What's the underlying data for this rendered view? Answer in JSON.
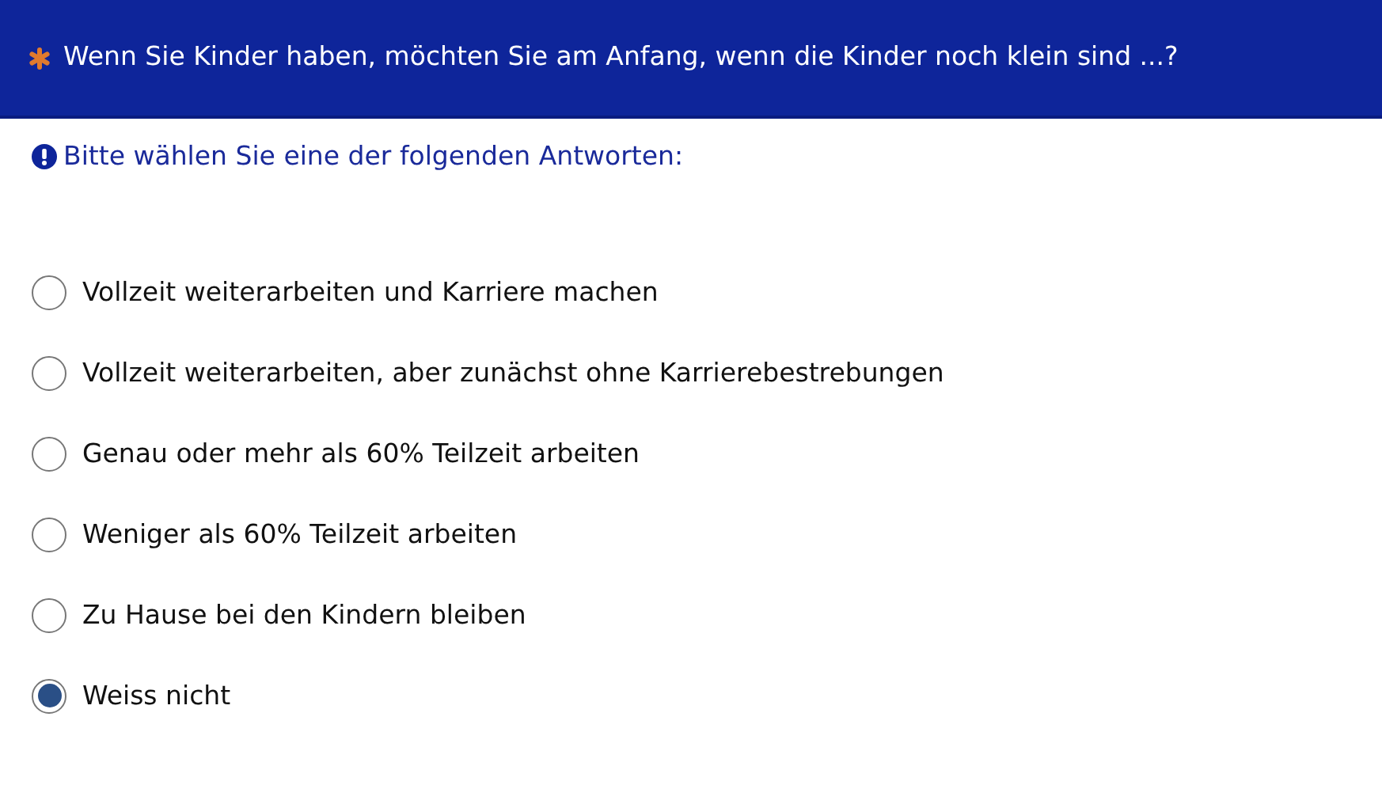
{
  "question": {
    "title": "Wenn Sie Kinder haben, möchten Sie am Anfang, wenn die Kinder noch klein sind ...?",
    "required": true
  },
  "instruction": "Bitte wählen Sie eine der folgenden Antworten:",
  "options": [
    {
      "label": "Vollzeit weiterarbeiten und Karriere machen",
      "selected": false
    },
    {
      "label": "Vollzeit weiterarbeiten, aber zunächst ohne Karrierebestrebungen",
      "selected": false
    },
    {
      "label": "Genau oder mehr als 60% Teilzeit arbeiten",
      "selected": false
    },
    {
      "label": "Weniger als 60% Teilzeit arbeiten",
      "selected": false
    },
    {
      "label": "Zu Hause bei den Kindern bleiben",
      "selected": false
    },
    {
      "label": "Weiss nicht",
      "selected": true
    }
  ]
}
